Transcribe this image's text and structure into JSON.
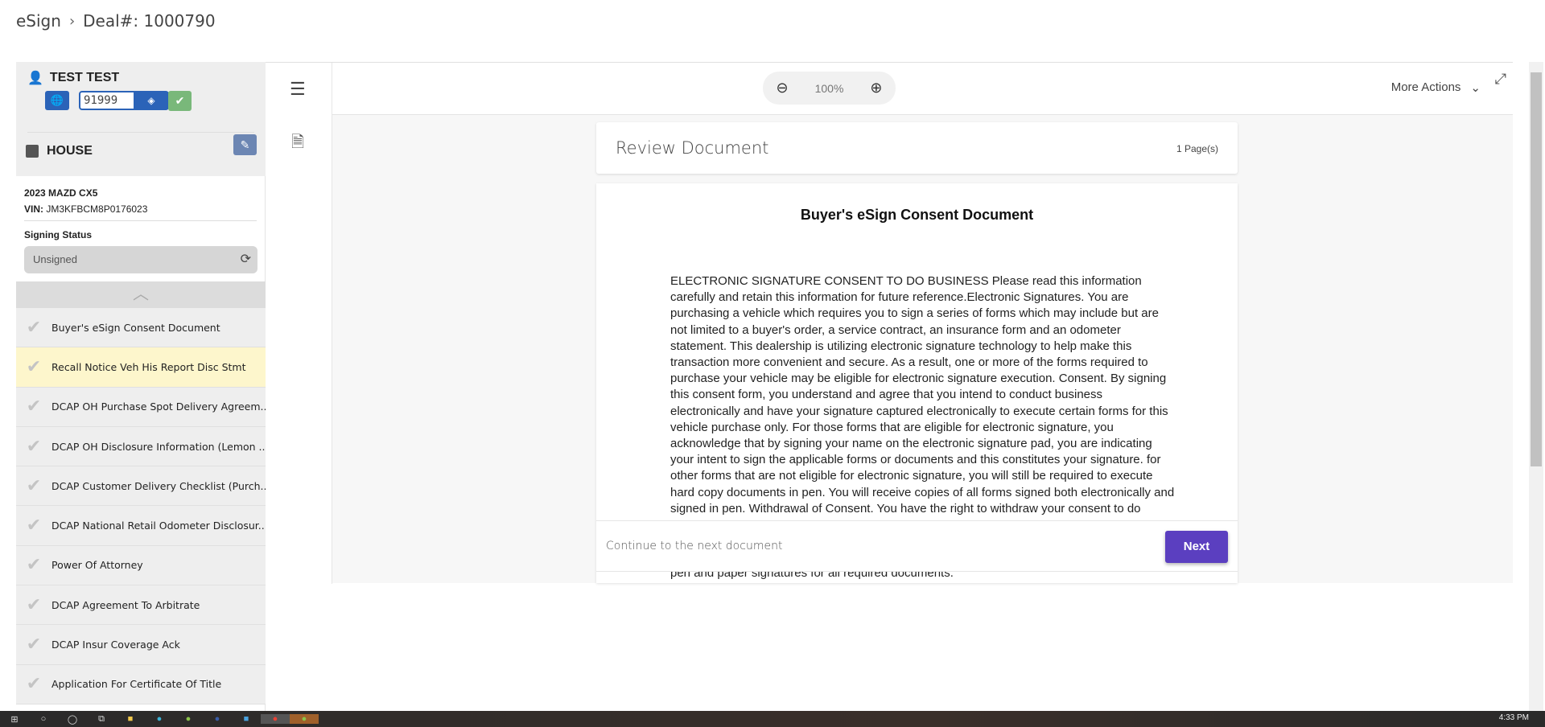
{
  "breadcrumb": {
    "root": "eSign",
    "current": "Deal#: 1000790"
  },
  "sidebar": {
    "customer_name": "TEST TEST",
    "code": "91999",
    "house_label": "HOUSE",
    "vehicle": "2023 MAZD CX5",
    "vin_label": "VIN:",
    "vin": "JM3KFBCM8P0176023",
    "signing_status_label": "Signing Status",
    "signing_status": "Unsigned",
    "documents": [
      {
        "label": "Buyer's eSign Consent Document",
        "active": false
      },
      {
        "label": "Recall Notice Veh His Report Disc Stmt",
        "active": true
      },
      {
        "label": "DCAP OH Purchase Spot Delivery Agreem...",
        "active": false
      },
      {
        "label": "DCAP OH Disclosure Information (Lemon ...",
        "active": false
      },
      {
        "label": "DCAP Customer Delivery Checklist (Purch...",
        "active": false
      },
      {
        "label": "DCAP National Retail Odometer Disclosur...",
        "active": false
      },
      {
        "label": "Power Of Attorney",
        "active": false
      },
      {
        "label": "DCAP Agreement To Arbitrate",
        "active": false
      },
      {
        "label": "DCAP Insur Coverage Ack",
        "active": false
      },
      {
        "label": "Application For Certificate Of Title",
        "active": false
      }
    ]
  },
  "toolbar": {
    "zoom": "100%",
    "more_actions": "More Actions"
  },
  "review": {
    "title": "Review Document",
    "pages": "1 Page(s)"
  },
  "document": {
    "title": "Buyer's eSign Consent Document",
    "lines": [
      "ELECTRONIC SIGNATURE CONSENT TO DO BUSINESS Please read this information",
      "carefully and retain this information for future reference.Electronic Signatures. You are",
      "purchasing a vehicle which requires you to sign a series of forms which may include but are",
      "not limited to a buyer's order, a service contract, an insurance form and an odometer",
      "statement. This dealership is utilizing electronic signature technology to help make this",
      "transaction more convenient and secure. As a result, one or more of the forms required to",
      "purchase your vehicle may be eligible for electronic signature execution. Consent. By signing",
      "this consent form, you understand and agree that you intend to conduct business",
      "electronically and have your signature captured electronically to execute certain forms for this",
      "vehicle purchase only. For those forms that are eligible for electronic signature, you",
      "acknowledge that by signing your name on the electronic signature pad, you are indicating",
      "your intent to sign the applicable forms or documents and this constitutes your signature. for",
      "other forms that are not eligible for electronic signature, you will still be required to execute",
      "hard copy documents in pen. You will receive copies of all forms signed both electronically and",
      "signed in pen. Withdrawal of Consent. You have the right to withdraw your consent to do"
    ],
    "last_line": "pen and paper signatures for all required documents."
  },
  "footer": {
    "prompt": "Continue to the next document",
    "next": "Next"
  },
  "taskbar": {
    "clock": "4:33 PM"
  },
  "colors": {
    "primary": "#2b63b8",
    "next_button": "#5b3fc0",
    "active_doc": "#fdf6cc",
    "success": "#79b87a"
  }
}
